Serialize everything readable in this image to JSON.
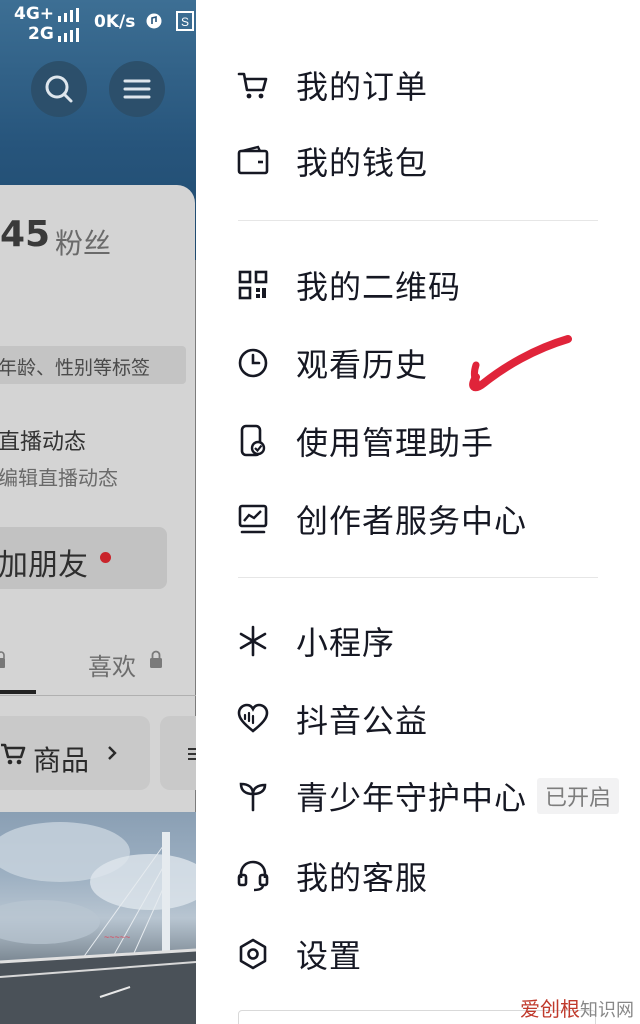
{
  "status_bar": {
    "network_top": "4G+",
    "network_bottom": "2G",
    "speed": "0K/s"
  },
  "profile": {
    "fans_count": "45",
    "fans_label": "粉丝",
    "tag_hint": "年龄、性别等标签",
    "live_title": "直播动态",
    "live_sub": "编辑直播动态",
    "add_friend": "加朋友",
    "tab_likes": "喜欢",
    "goods": "商品"
  },
  "drawer": {
    "group1": [
      {
        "label": "我的订单",
        "icon": "cart-icon"
      },
      {
        "label": "我的钱包",
        "icon": "wallet-icon"
      }
    ],
    "group2": [
      {
        "label": "我的二维码",
        "icon": "qrcode-icon"
      },
      {
        "label": "观看历史",
        "icon": "clock-icon"
      },
      {
        "label": "使用管理助手",
        "icon": "phone-check-icon"
      },
      {
        "label": "创作者服务中心",
        "icon": "monitor-chart-icon"
      }
    ],
    "group3": [
      {
        "label": "小程序",
        "icon": "asterisk-icon"
      },
      {
        "label": "抖音公益",
        "icon": "heart-pulse-icon"
      },
      {
        "label": "青少年守护中心",
        "icon": "sprout-icon",
        "badge": "已开启"
      },
      {
        "label": "我的客服",
        "icon": "headset-icon"
      },
      {
        "label": "设置",
        "icon": "hexagon-gear-icon"
      }
    ]
  },
  "watermark": {
    "text_a": "爱创根",
    "text_b": "知识网"
  },
  "colors": {
    "accent_red": "#e0243a",
    "drawer_bg": "#ffffff",
    "text": "#161823"
  }
}
